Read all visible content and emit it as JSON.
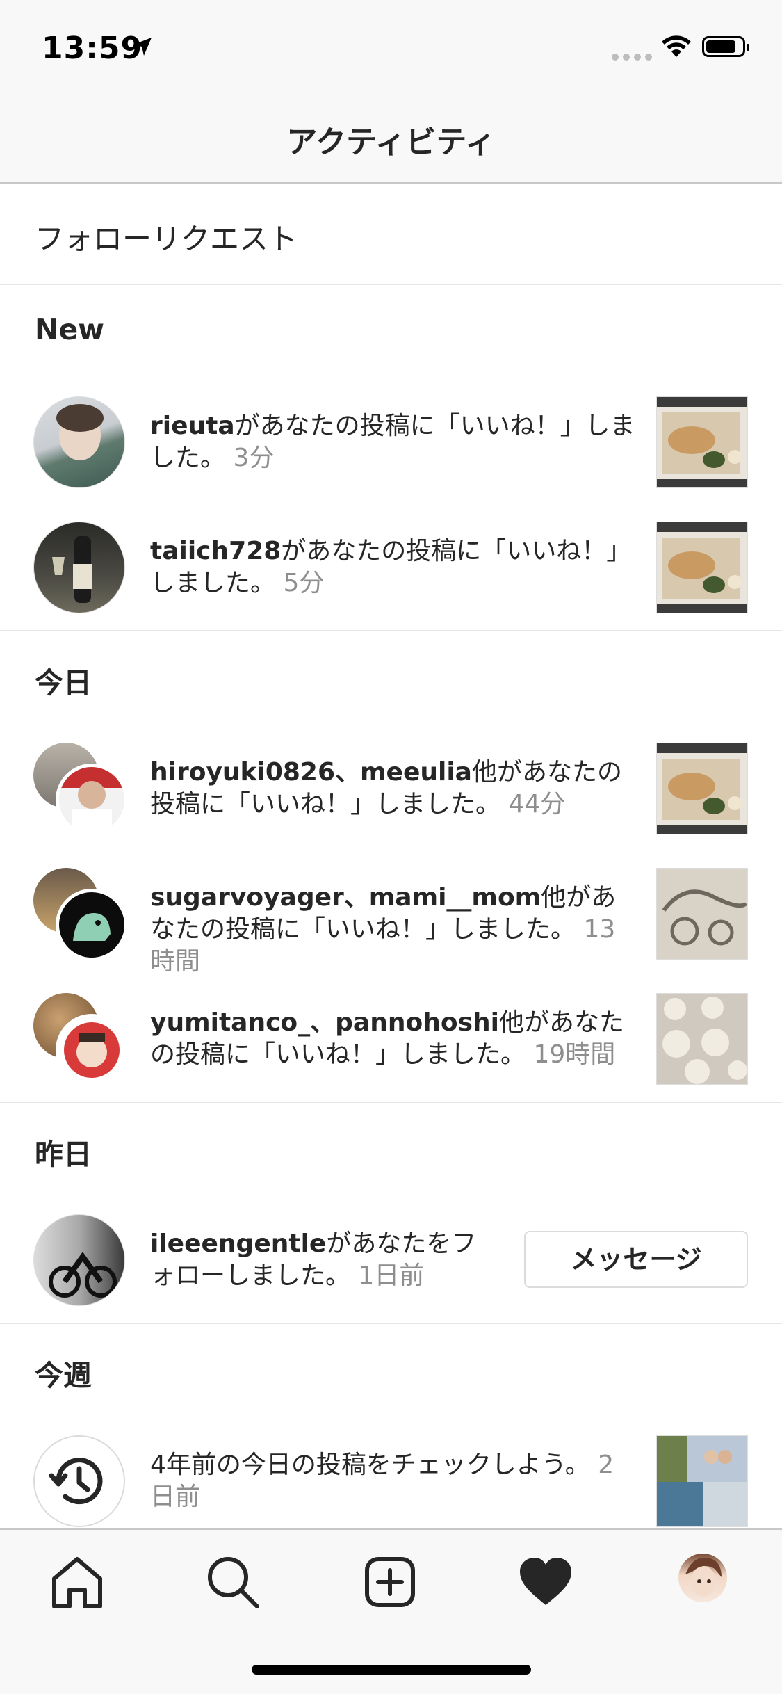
{
  "status": {
    "time": "13:59"
  },
  "nav": {
    "title": "アクティビティ"
  },
  "follow_requests": {
    "label": "フォローリクエスト"
  },
  "sections": {
    "new": "New",
    "today": "今日",
    "yesterday": "昨日",
    "this_week": "今週"
  },
  "items": [
    {
      "user": "rieuta",
      "text": "があなたの投稿に「いいね！」しました。",
      "time": "3分"
    },
    {
      "user": "taiich728",
      "text": "があなたの投稿に「いいね！」しました。",
      "time": "5分"
    },
    {
      "user": "hiroyuki0826、meeulia",
      "text": "他があなたの投稿に「いいね！」しました。",
      "time": "44分"
    },
    {
      "user": "sugarvoyager、mami__mom",
      "text": "他があなたの投稿に「いいね！」しました。",
      "time": "13時間"
    },
    {
      "user": "yumitanco_、pannohoshi",
      "text": "他があなたの投稿に「いいね！」しました。",
      "time": "19時間"
    },
    {
      "user": "ileeengentle",
      "text": "があなたをフォローしました。",
      "time": "1日前",
      "button": "メッセージ"
    },
    {
      "user": "",
      "text": "4年前の今日の投稿をチェックしよう。",
      "time": "2日前"
    }
  ],
  "icons": {
    "status": [
      "location-arrow-icon",
      "cellular-signal-icon",
      "wifi-icon",
      "battery-icon"
    ],
    "tabs": [
      "home-icon",
      "search-icon",
      "new-post-icon",
      "heart-icon",
      "profile-avatar"
    ],
    "memory": "history-icon"
  },
  "colors": {
    "text": "#262626",
    "secondary": "#8e8e8e",
    "bar": "#f8f8f8",
    "divider": "#e6e6e6"
  }
}
